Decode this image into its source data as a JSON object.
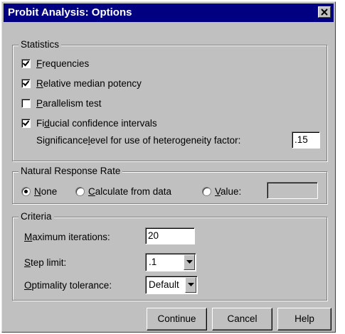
{
  "window": {
    "title": "Probit Analysis: Options",
    "close_icon": "close-icon"
  },
  "statistics": {
    "legend": "Statistics",
    "frequencies": {
      "label_u": "F",
      "label_rest": "requencies",
      "checked": true
    },
    "relative_median_potency": {
      "label_u": "R",
      "label_rest": "elative median potency",
      "checked": true
    },
    "parallelism_test": {
      "label_u": "P",
      "label_rest": "arallelism test",
      "checked": false
    },
    "fiducial": {
      "label_pre": "Fi",
      "label_u": "d",
      "label_rest": "ucial confidence intervals",
      "checked": true
    },
    "significance_label_pre": "Significance ",
    "significance_label_u": "l",
    "significance_label_rest": "evel for use of heterogeneity factor:",
    "significance_value": ".15"
  },
  "natural_response": {
    "legend": "Natural Response Rate",
    "none": {
      "label_u": "N",
      "label_rest": "one",
      "selected": true
    },
    "calculate": {
      "label_u": "C",
      "label_rest": "alculate from data",
      "selected": false
    },
    "value": {
      "label_u": "V",
      "label_rest": "alue:",
      "selected": false,
      "input_value": ""
    }
  },
  "criteria": {
    "legend": "Criteria",
    "max_iterations": {
      "label_u": "M",
      "label_rest": "aximum iterations:",
      "value": "20"
    },
    "step_limit": {
      "label_u": "S",
      "label_rest": "tep limit:",
      "value": ".1"
    },
    "optimality": {
      "label_u": "O",
      "label_rest": "ptimality tolerance:",
      "value": "Default"
    }
  },
  "buttons": {
    "continue": "Continue",
    "cancel": "Cancel",
    "help": "Help"
  },
  "colors": {
    "face": "#c0c0c0",
    "titlebar": "#000080"
  }
}
